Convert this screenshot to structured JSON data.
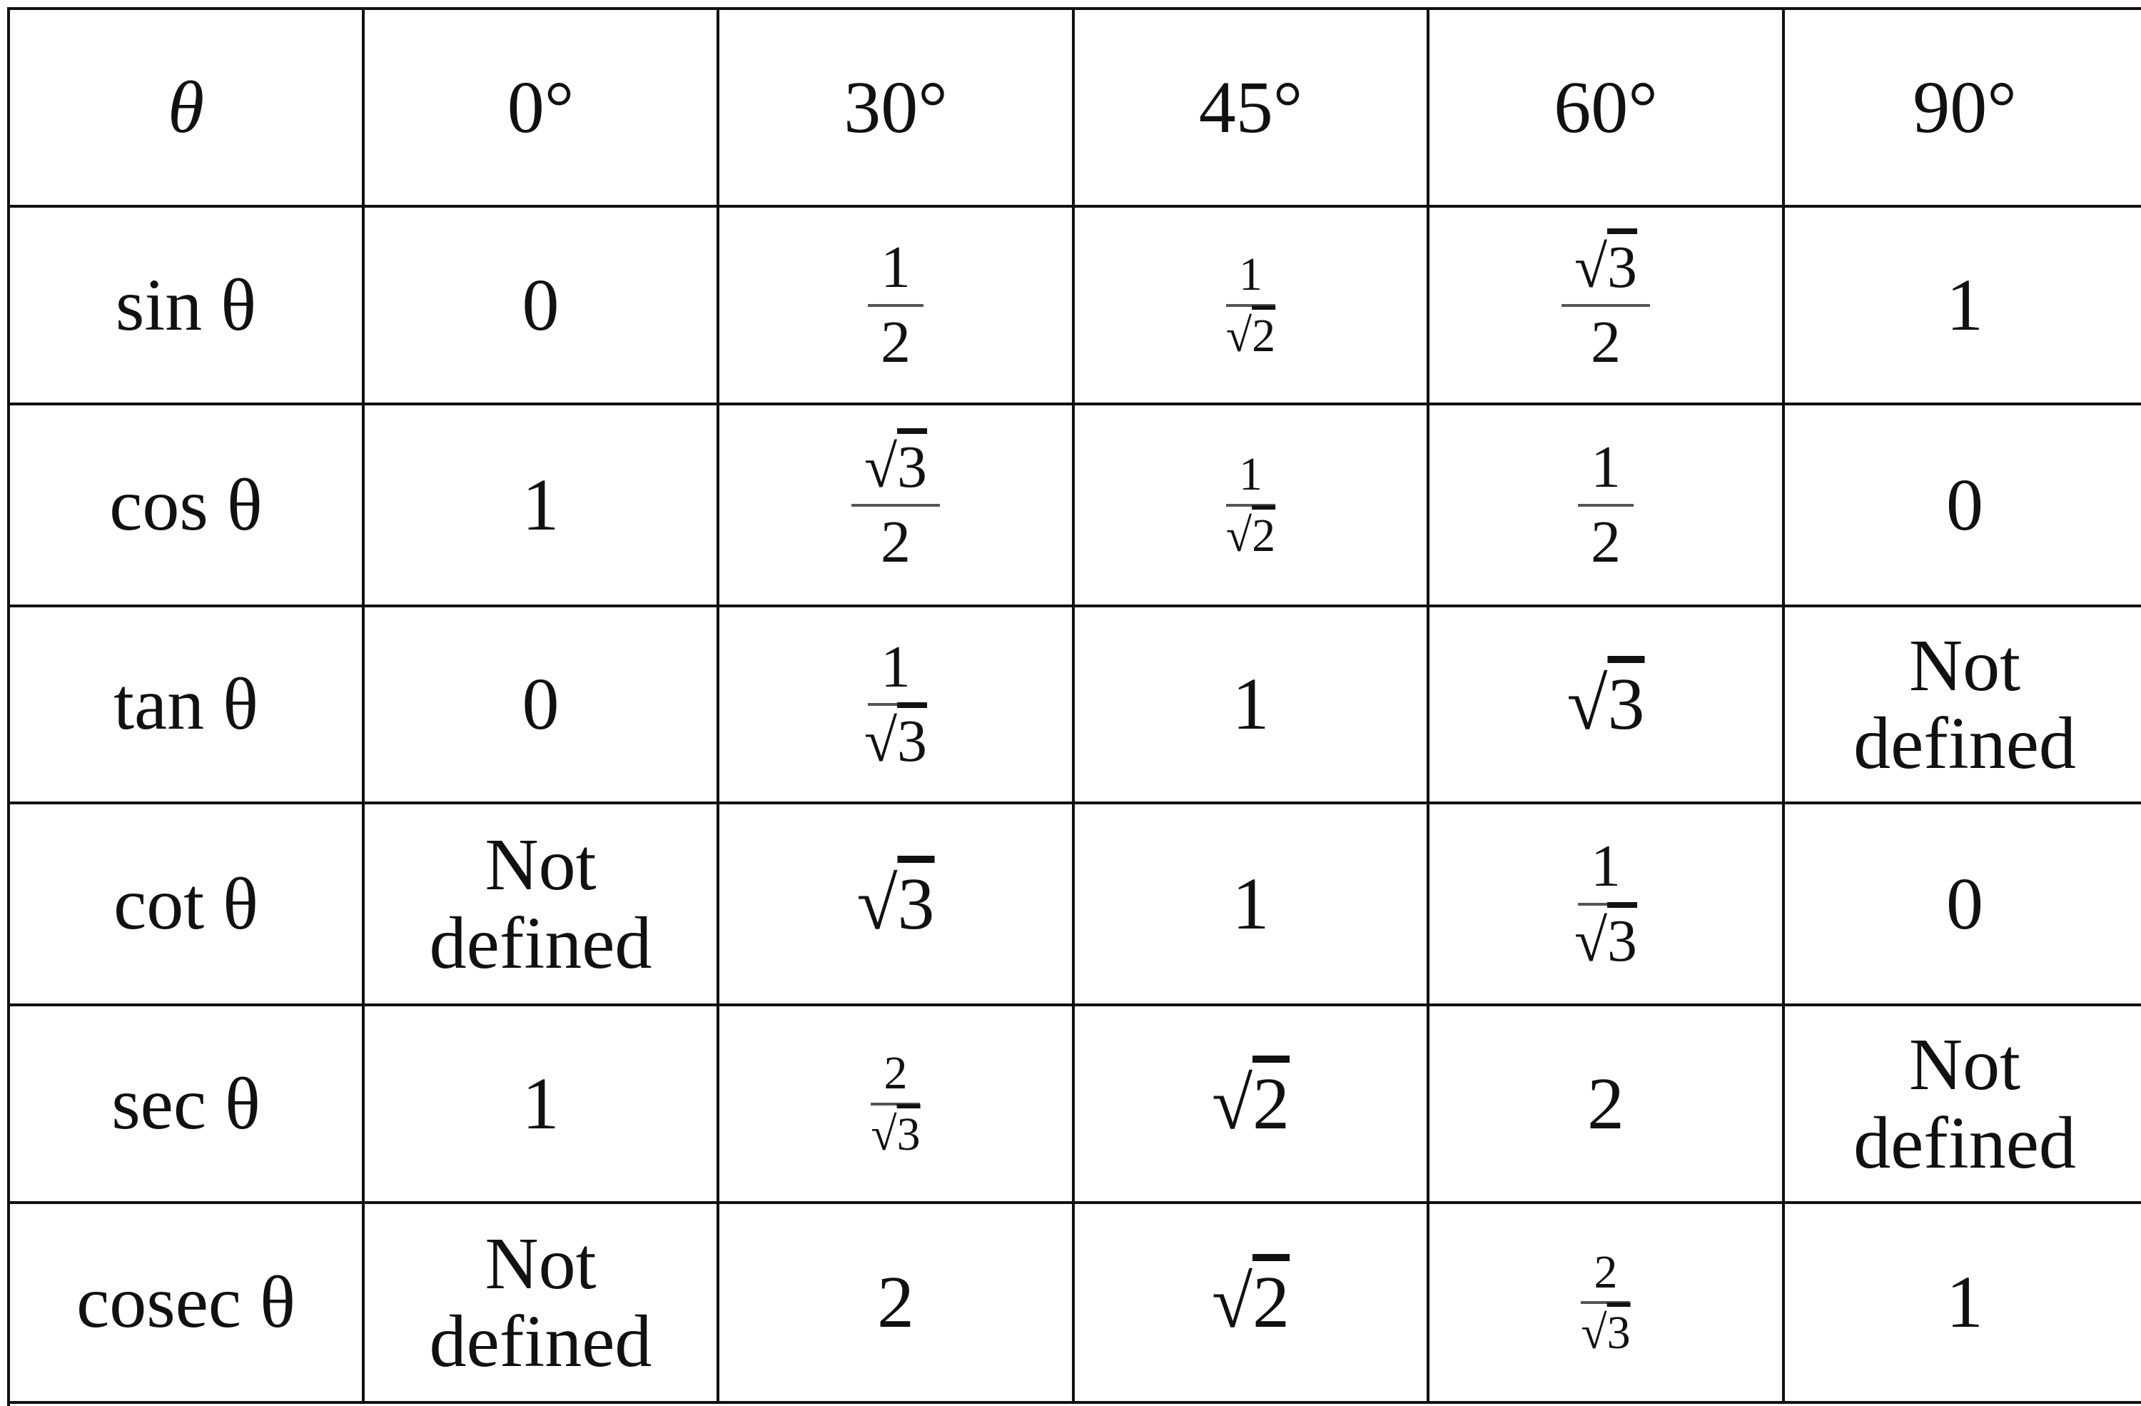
{
  "header": [
    "θ",
    "0°",
    "30°",
    "45°",
    "60°",
    "90°"
  ],
  "rows": [
    {
      "func": "sin θ",
      "cells": [
        {
          "text": "0"
        },
        {
          "num": "1",
          "den": "2"
        },
        {
          "num": "1",
          "den": "√2",
          "small": true
        },
        {
          "num": "√3",
          "den": "2"
        },
        {
          "text": "1"
        }
      ]
    },
    {
      "func": "cos θ",
      "cells": [
        {
          "text": "1"
        },
        {
          "num": "√3",
          "den": "2"
        },
        {
          "num": "1",
          "den": "√2",
          "small": true
        },
        {
          "num": "1",
          "den": "2"
        },
        {
          "text": "0"
        }
      ]
    },
    {
      "func": "tan θ",
      "cells": [
        {
          "text": "0"
        },
        {
          "num": "1",
          "den": "√3"
        },
        {
          "text": "1"
        },
        {
          "text": "√3"
        },
        {
          "text": "Not defined"
        }
      ]
    },
    {
      "func": "cot θ",
      "cells": [
        {
          "text": "Not defined"
        },
        {
          "text": "√3"
        },
        {
          "text": "1"
        },
        {
          "num": "1",
          "den": "√3"
        },
        {
          "text": "0"
        }
      ]
    },
    {
      "func": "sec θ",
      "cells": [
        {
          "text": "1"
        },
        {
          "num": "2",
          "den": "√3",
          "small": true
        },
        {
          "text": "√2"
        },
        {
          "text": "2"
        },
        {
          "text": "Not defined"
        }
      ]
    },
    {
      "func": "cosec θ",
      "cells": [
        {
          "text": "Not defined"
        },
        {
          "text": "2"
        },
        {
          "text": "√2"
        },
        {
          "num": "2",
          "den": "√3",
          "small": true
        },
        {
          "text": "1"
        }
      ]
    }
  ]
}
